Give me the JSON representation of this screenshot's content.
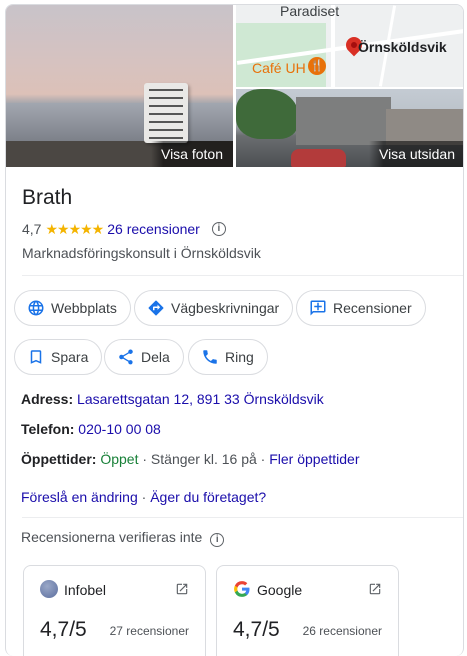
{
  "photos": {
    "main_label": "Visa foton",
    "street_label": "Visa utsidan",
    "map": {
      "place_top": "Paradiset",
      "place_town": "Örnsköldsvik",
      "place_cafe": "Café UH"
    }
  },
  "business": {
    "name": "Brath",
    "rating": "4,7",
    "stars": "★★★★★",
    "reviews_link": "26 recensioner",
    "category": "Marknadsföringskonsult i Örnsköldsvik"
  },
  "actions": {
    "website": "Webbplats",
    "directions": "Vägbeskrivningar",
    "reviews": "Recensioner",
    "save": "Spara",
    "share": "Dela",
    "call": "Ring"
  },
  "details": {
    "address_label": "Adress:",
    "address_value": "Lasarettsgatan 12, 891 33 Örnsköldsvik",
    "phone_label": "Telefon:",
    "phone_value": "020-10 00 08",
    "hours_label": "Öppettider:",
    "hours_status": "Öppet",
    "hours_closes": " · Stänger kl. 16 på · ",
    "hours_more": "Fler öppettider"
  },
  "suggest": {
    "edit": "Föreslå en ändring",
    "sep": " · ",
    "owner": "Äger du företaget?"
  },
  "verify_note": "Recensionerna verifieras inte",
  "sources": [
    {
      "name": "Infobel",
      "score": "4,7/5",
      "count": "27 recensioner"
    },
    {
      "name": "Google",
      "score": "4,7/5",
      "count": "26 recensioner"
    }
  ],
  "colors": {
    "link": "#1a0dab",
    "accent": "#1a73e8",
    "open": "#188038",
    "star": "#f4b400"
  }
}
